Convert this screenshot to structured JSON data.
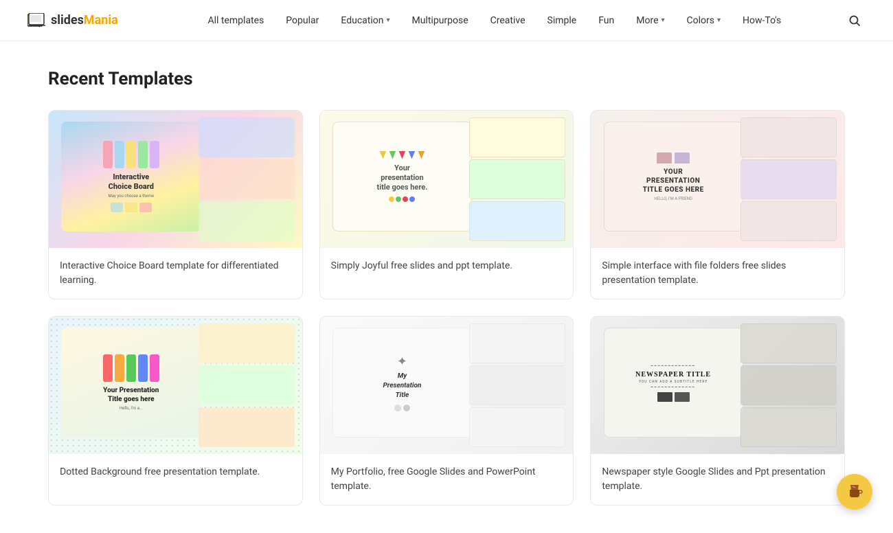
{
  "logo": {
    "slides": "slides",
    "mania": "Mania"
  },
  "nav": {
    "items": [
      {
        "label": "All templates",
        "hasDropdown": false,
        "active": false
      },
      {
        "label": "Popular",
        "hasDropdown": false,
        "active": false
      },
      {
        "label": "Education",
        "hasDropdown": true,
        "active": false
      },
      {
        "label": "Multipurpose",
        "hasDropdown": false,
        "active": false
      },
      {
        "label": "Creative",
        "hasDropdown": false,
        "active": false
      },
      {
        "label": "Simple",
        "hasDropdown": false,
        "active": false
      },
      {
        "label": "Fun",
        "hasDropdown": false,
        "active": false
      },
      {
        "label": "More",
        "hasDropdown": true,
        "active": false
      },
      {
        "label": "Colors",
        "hasDropdown": true,
        "active": false
      },
      {
        "label": "How-To's",
        "hasDropdown": false,
        "active": false
      }
    ]
  },
  "section": {
    "title": "Recent Templates"
  },
  "templates": [
    {
      "id": "card1",
      "title_line1": "Interactive",
      "title_line2": "Choice Board",
      "description": "Interactive Choice Board template for differentiated learning.",
      "thumb_type": "choice-board"
    },
    {
      "id": "card2",
      "title_line1": "Your",
      "title_line2": "presentation",
      "title_line3": "title goes here.",
      "description": "Simply Joyful free slides and ppt template.",
      "thumb_type": "simply-joyful"
    },
    {
      "id": "card3",
      "title_line1": "YOUR",
      "title_line2": "PRESENTATION",
      "title_line3": "TITLE GOES HERE",
      "description": "Simple interface with file folders free slides presentation template.",
      "thumb_type": "file-folders"
    },
    {
      "id": "card4",
      "title_line1": "Your Presentation",
      "title_line2": "Title goes here",
      "description": "Dotted Background free presentation template.",
      "thumb_type": "dotted-background"
    },
    {
      "id": "card5",
      "title_line1": "My",
      "title_line2": "Presentation",
      "title_line3": "Title",
      "description": "My Portfolio, free Google Slides and PowerPoint template.",
      "thumb_type": "portfolio"
    },
    {
      "id": "card6",
      "title_line1": "NEWSPAPER TITLE",
      "description": "Newspaper style Google Slides and Ppt presentation template.",
      "thumb_type": "newspaper"
    }
  ],
  "fab": {
    "icon": "coffee-cup",
    "color": "#f4c842"
  }
}
